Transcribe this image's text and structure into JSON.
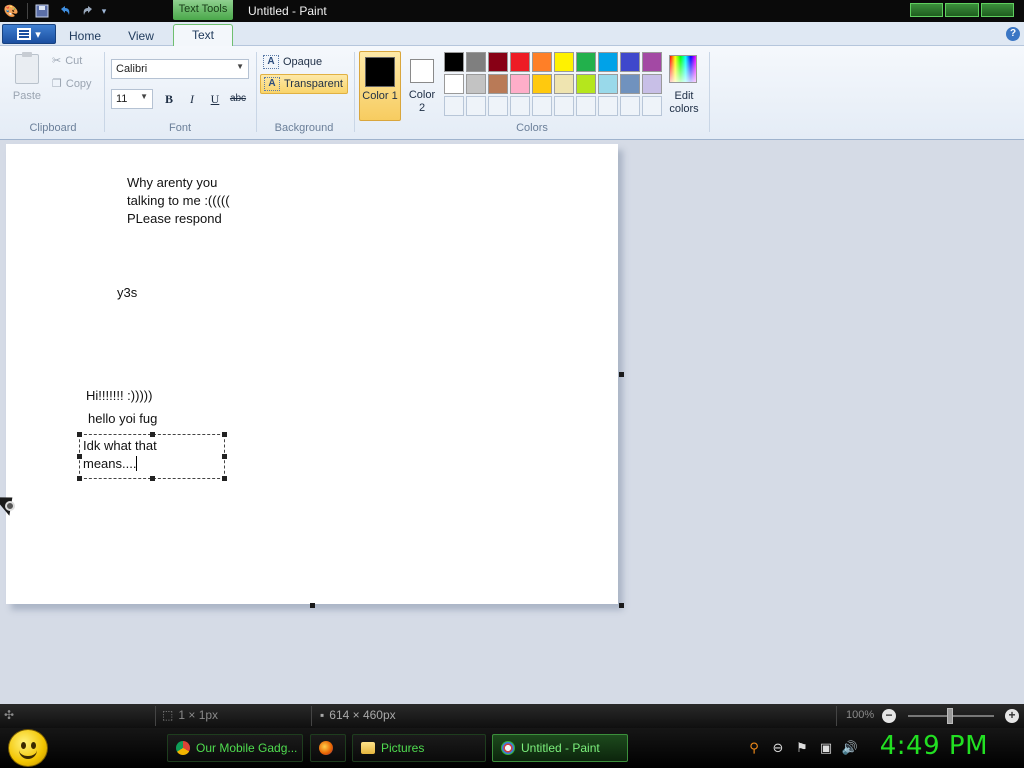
{
  "titlebar": {
    "context_tab": "Text Tools",
    "window_title": "Untitled - Paint"
  },
  "ribbon_tabs": {
    "home": "Home",
    "view": "View",
    "text": "Text"
  },
  "clipboard": {
    "paste": "Paste",
    "cut": "Cut",
    "copy": "Copy",
    "group_label": "Clipboard"
  },
  "font": {
    "family": "Calibri",
    "size": "11",
    "bold": "B",
    "italic": "I",
    "underline": "U",
    "strikethrough": "abc",
    "group_label": "Font"
  },
  "background": {
    "opaque": "Opaque",
    "transparent": "Transparent",
    "group_label": "Background",
    "selected": "Transparent"
  },
  "colors": {
    "color1_label": "Color 1",
    "color1_value": "#000000",
    "color2_label": "Color 2",
    "color2_value": "#ffffff",
    "edit_label": "Edit colors",
    "group_label": "Colors",
    "palette_row1": [
      "#000000",
      "#7f7f7f",
      "#880015",
      "#ed1c24",
      "#ff7f27",
      "#fff200",
      "#22b14c",
      "#00a2e8",
      "#3f48cc",
      "#a349a4"
    ],
    "palette_row2": [
      "#ffffff",
      "#c3c3c3",
      "#b97a57",
      "#ffaec9",
      "#ffc90e",
      "#efe4b0",
      "#b5e61d",
      "#99d9ea",
      "#7092be",
      "#c8bfe7"
    ]
  },
  "canvas_text": {
    "line1": "Why arenty you",
    "line2": "talking to me :(((((",
    "line3": "PLease respond",
    "line4": "y3s",
    "line5": "Hi!!!!!!! :)))))",
    "line6": "hello yoi fug",
    "active_line1": "Idk what that",
    "active_line2": "means...."
  },
  "statusbar": {
    "selection_size": "1 × 1px",
    "canvas_size": "614 × 460px",
    "zoom": "100%"
  },
  "taskbar": {
    "items": [
      {
        "label": "Our Mobile Gadg...",
        "icon": "chrome-icon"
      },
      {
        "label": "",
        "icon": "firefox-icon"
      },
      {
        "label": "Pictures",
        "icon": "folder-icon"
      },
      {
        "label": "Untitled - Paint",
        "icon": "paint-icon"
      }
    ],
    "clock": "4:49 PM"
  }
}
